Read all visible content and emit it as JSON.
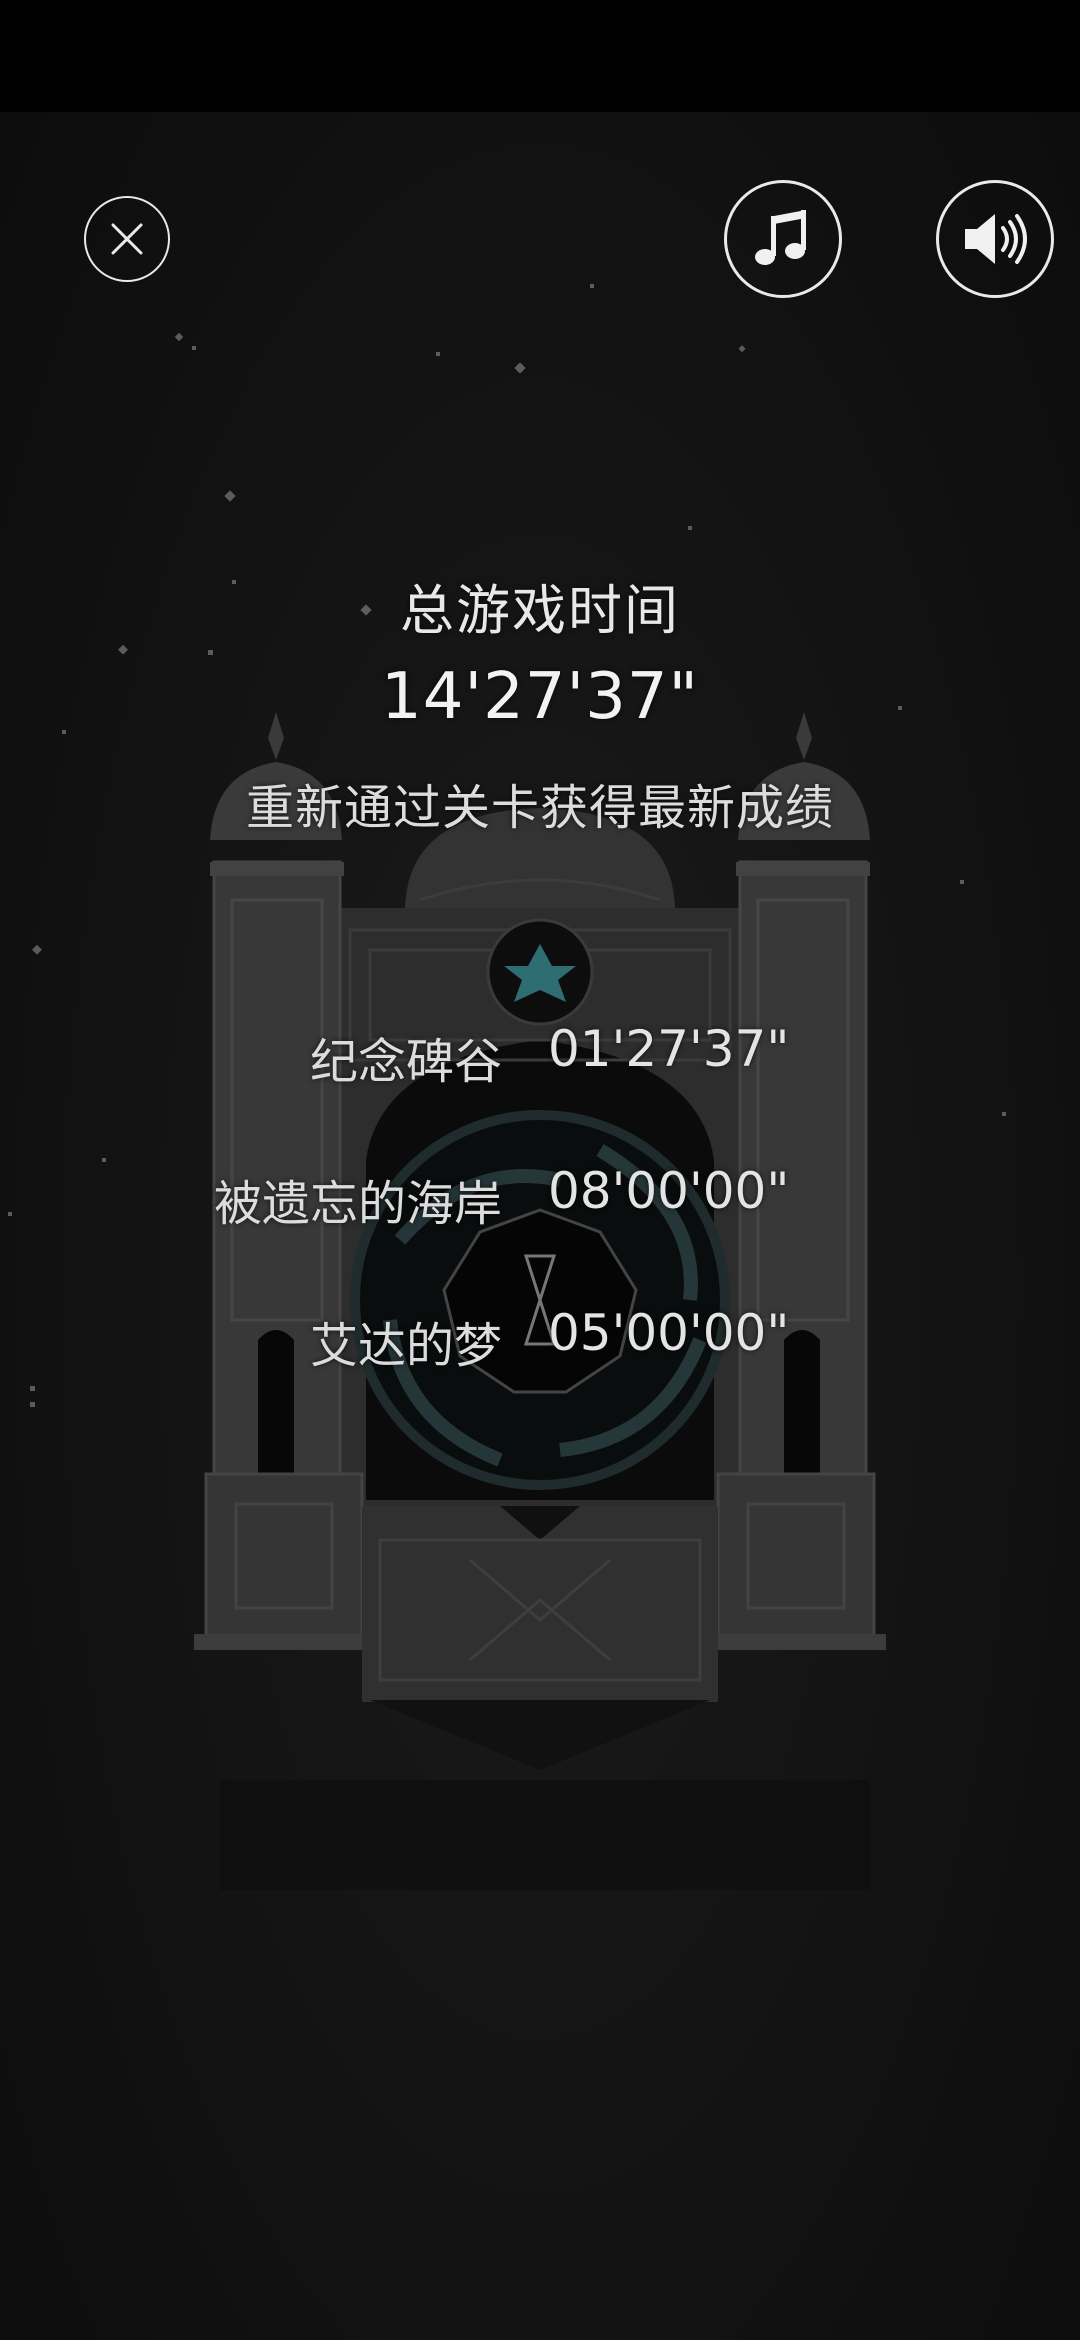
{
  "controls": {
    "close_icon": "close-icon",
    "music_icon": "music-note-icon",
    "sound_icon": "speaker-icon"
  },
  "stats": {
    "title": "总游戏时间",
    "total_time": "14'27'37\"",
    "subtitle": "重新通过关卡获得最新成绩"
  },
  "levels": [
    {
      "name": "纪念碑谷",
      "time": "01'27'37\""
    },
    {
      "name": "被遗忘的海岸",
      "time": "08'00'00\""
    },
    {
      "name": "艾达的梦",
      "time": "05'00'00\""
    }
  ],
  "colors": {
    "background": "#141414",
    "text": "#e8e8e8",
    "icon_stroke": "#e9e9e9",
    "emblem_accent": "#3a8f96"
  }
}
